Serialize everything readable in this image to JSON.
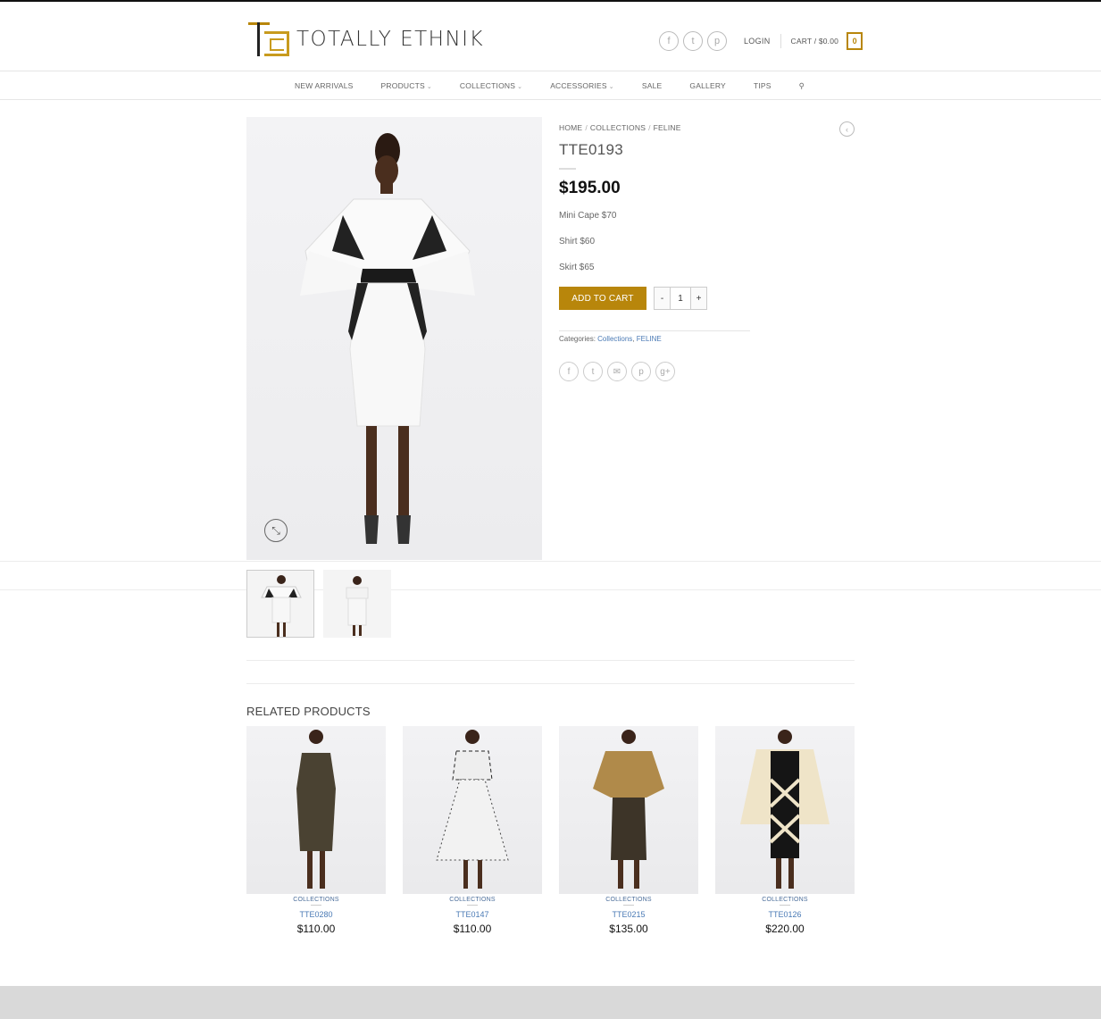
{
  "brand": {
    "name": "TOTALLY ETHNIK"
  },
  "header": {
    "social": [
      "facebook-icon",
      "twitter-icon",
      "pinterest-icon"
    ],
    "login_label": "LOGIN",
    "cart_label": "CART / $0.00",
    "cart_count": "0"
  },
  "nav": {
    "items": [
      {
        "label": "NEW ARRIVALS",
        "dropdown": false
      },
      {
        "label": "PRODUCTS",
        "dropdown": true
      },
      {
        "label": "COLLECTIONS",
        "dropdown": true
      },
      {
        "label": "ACCESSORIES",
        "dropdown": true
      },
      {
        "label": "SALE",
        "dropdown": false
      },
      {
        "label": "GALLERY",
        "dropdown": false
      },
      {
        "label": "TIPS",
        "dropdown": false
      }
    ]
  },
  "breadcrumb": {
    "items": [
      "HOME",
      "COLLECTIONS",
      "FELINE"
    ],
    "separator": "/"
  },
  "product": {
    "title": "TTE0193",
    "price": "$195.00",
    "desc": [
      "Mini Cape $70",
      "Shirt $60",
      "Skirt $65"
    ],
    "add_to_cart_label": "ADD TO CART",
    "qty_minus": "-",
    "qty_value": "1",
    "qty_plus": "+",
    "categories_label": "Categories:",
    "categories": [
      "Collections",
      "FELINE"
    ]
  },
  "share_icons": [
    "facebook-icon",
    "twitter-icon",
    "email-icon",
    "pinterest-icon",
    "google-plus-icon"
  ],
  "related": {
    "title": "RELATED PRODUCTS",
    "items": [
      {
        "category": "COLLECTIONS",
        "name": "TTE0280",
        "price": "$110.00"
      },
      {
        "category": "COLLECTIONS",
        "name": "TTE0147",
        "price": "$110.00"
      },
      {
        "category": "COLLECTIONS",
        "name": "TTE0215",
        "price": "$135.00"
      },
      {
        "category": "COLLECTIONS",
        "name": "TTE0126",
        "price": "$220.00"
      }
    ]
  },
  "colors": {
    "accent": "#b8860b",
    "link": "#4a7ab5"
  }
}
